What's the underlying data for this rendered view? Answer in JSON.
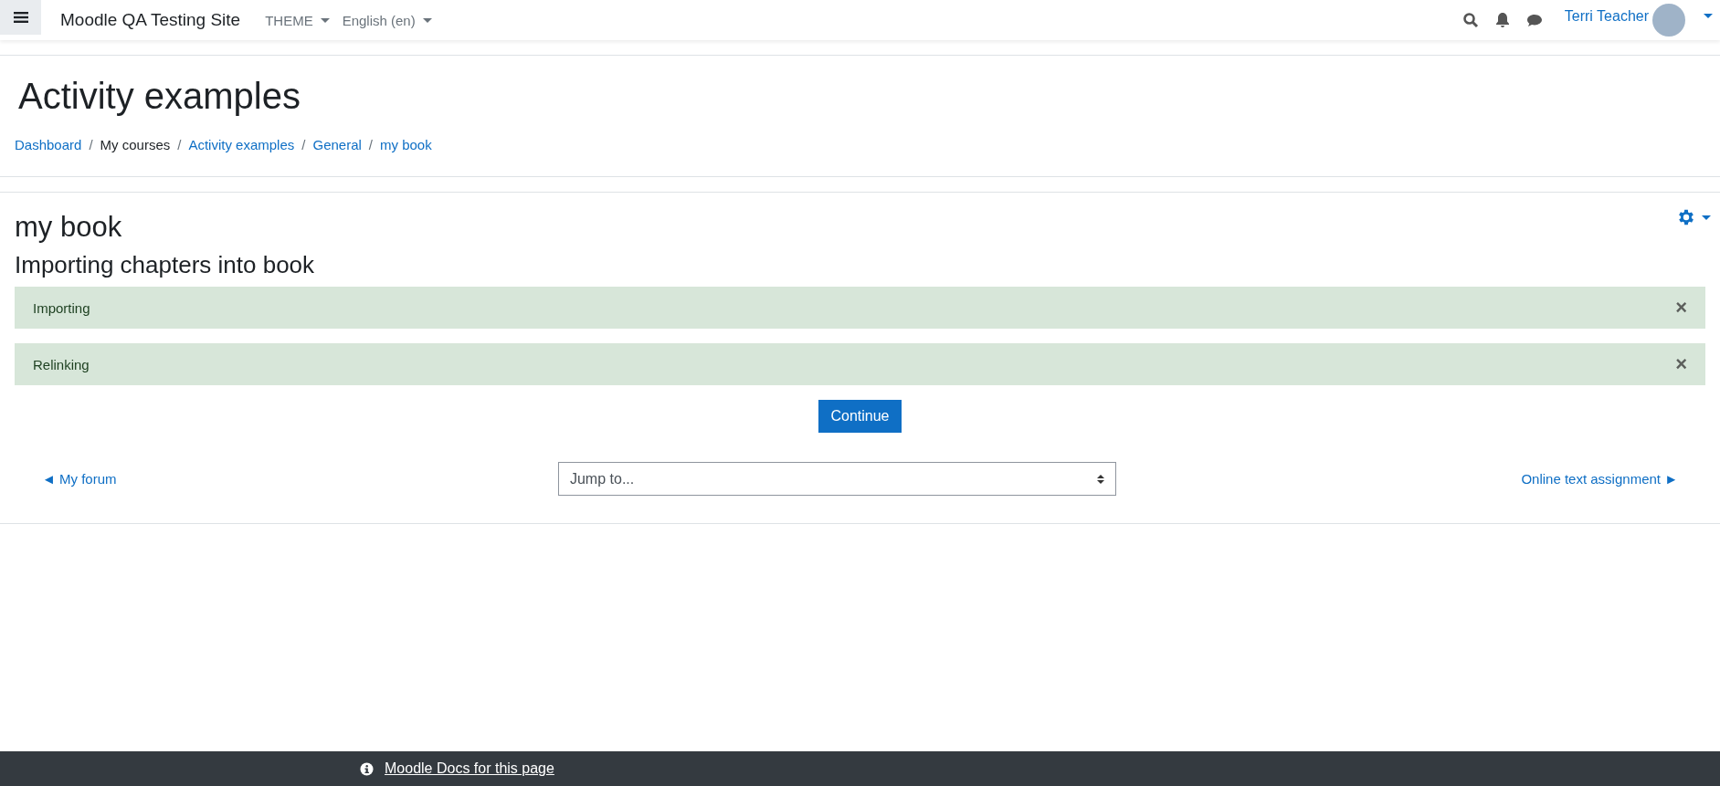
{
  "navbar": {
    "site_name": "Moodle QA Testing Site",
    "menus": [
      "THEME",
      "English (en)"
    ],
    "user_name": "Terri Teacher"
  },
  "page_header": {
    "title": "Activity examples",
    "breadcrumb": [
      {
        "label": "Dashboard",
        "link": true
      },
      {
        "label": "My courses",
        "link": false
      },
      {
        "label": "Activity examples",
        "link": true
      },
      {
        "label": "General",
        "link": true
      },
      {
        "label": "my book",
        "link": true
      }
    ],
    "separator": "/"
  },
  "main": {
    "title": "my book",
    "subtitle": "Importing chapters into book",
    "alerts": [
      {
        "text": "Importing",
        "close": "×"
      },
      {
        "text": "Relinking",
        "close": "×"
      }
    ],
    "continue_button": "Continue",
    "prev_link": "◄ My forum",
    "jump_select": {
      "value": "Jump to..."
    },
    "next_link": "Online text assignment ►"
  },
  "footer": {
    "docs_link": "Moodle Docs for this page"
  }
}
